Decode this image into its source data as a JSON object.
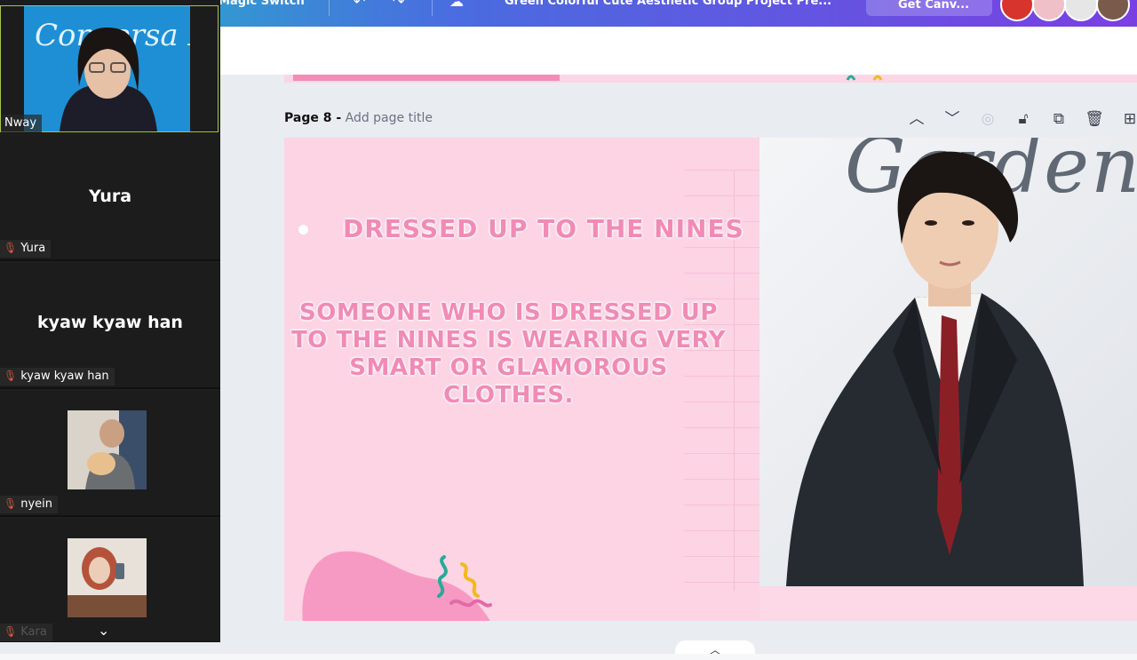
{
  "topbar": {
    "magic_switch": "Magic Switch",
    "doc_title": "Green Colorful Cute Aesthetic Group Project Pre...",
    "get_canva": "Get Canv...",
    "undo_icon": "undo-icon",
    "redo_icon": "redo-icon",
    "cloud_icon": "cloud-icon"
  },
  "page": {
    "label": "Page 8 -",
    "title_placeholder": "Add page title"
  },
  "slide": {
    "heading": "DRESSED UP TO THE NINES",
    "body": "SOMEONE WHO IS DRESSED UP TO THE NINES IS WEARING VERY SMART OR GLAMOROUS CLOTHES.",
    "photo_text": "Garden"
  },
  "participants": [
    {
      "name": "Nway",
      "video": true,
      "muted": false
    },
    {
      "name": "Yura",
      "video": false,
      "muted": true
    },
    {
      "name": "kyaw kyaw han",
      "video": false,
      "muted": true
    },
    {
      "name": "nyein",
      "video": true,
      "muted": true
    },
    {
      "name": "Kara",
      "video": true,
      "muted": true
    }
  ],
  "video_bg_text": "Conversa English",
  "colors": {
    "slide_pink": "#fcd4e4",
    "text_pink": "#f08bb6",
    "sidebar": "#1f1f1f",
    "mic_off": "#e0533c"
  }
}
